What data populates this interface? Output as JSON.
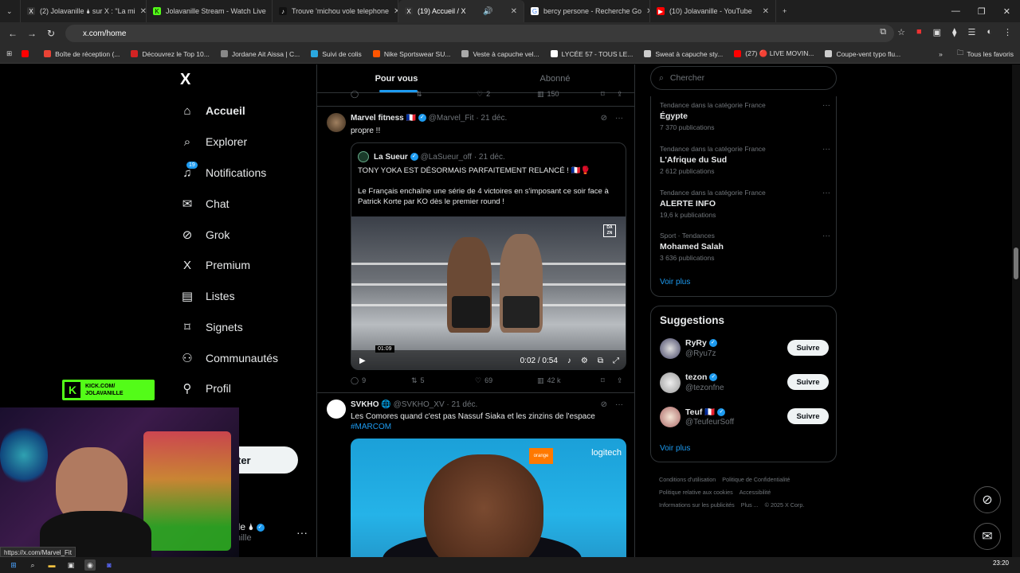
{
  "browser": {
    "tabs": [
      {
        "label": "(2) Jolavanille 🌢 sur X : \"La mi",
        "color": "#000000",
        "glyph": "X"
      },
      {
        "label": "Jolavanille Stream - Watch Live",
        "color": "#53fc18",
        "glyph": "K"
      },
      {
        "label": "Trouve 'michou vole telephone",
        "color": "#111111",
        "glyph": "♪"
      },
      {
        "label": "(19) Accueil / X",
        "color": "#000000",
        "glyph": "X"
      },
      {
        "label": "bercy persone - Recherche Go",
        "color": "#4285f4",
        "glyph": "G"
      },
      {
        "label": "(10) Jolavanille - YouTube",
        "color": "#ff0000",
        "glyph": "▶"
      }
    ],
    "address": "x.com/home",
    "bookmarks": [
      {
        "label": "",
        "color": "#ff0000"
      },
      {
        "label": "",
        "color": "#ea4335"
      },
      {
        "label": "Boîte de réception (...",
        "color": "#ea4335"
      },
      {
        "label": "Découvrez le Top 10...",
        "color": "#d32323"
      },
      {
        "label": "Jordane Ait Aissa | C...",
        "color": "#888888"
      },
      {
        "label": "Suivi de colis",
        "color": "#2aa8e0"
      },
      {
        "label": "Nike Sportswear SU...",
        "color": "#ff5500"
      },
      {
        "label": "Veste à capuche vel...",
        "color": "#aaaaaa"
      },
      {
        "label": "LYCÉE 57 - TOUS LE...",
        "color": "#ffffff"
      },
      {
        "label": "Sweat à capuche sty...",
        "color": "#cccccc"
      },
      {
        "label": "(27) 🔴 LIVE MOVIN...",
        "color": "#ff0000"
      },
      {
        "label": "Coupe-vent typo flu...",
        "color": "#cccccc"
      }
    ],
    "all_favs": "Tous les favoris",
    "status_url": "https://x.com/Marvel_Fit"
  },
  "sidebar": {
    "logo": "X",
    "items": [
      {
        "label": "Accueil",
        "icon": "home-icon",
        "glyph": "⌂",
        "bold": true
      },
      {
        "label": "Explorer",
        "icon": "search-icon",
        "glyph": "⌕",
        "bold": false
      },
      {
        "label": "Notifications",
        "icon": "bell-icon",
        "glyph": "🔔",
        "bold": false,
        "badge": "19"
      },
      {
        "label": "Chat",
        "icon": "mail-icon",
        "glyph": "✉",
        "bold": false
      },
      {
        "label": "Grok",
        "icon": "grok-icon",
        "glyph": "⊘",
        "bold": false
      },
      {
        "label": "Premium",
        "icon": "x-premium-icon",
        "glyph": "X",
        "bold": false
      },
      {
        "label": "Listes",
        "icon": "list-icon",
        "glyph": "▤",
        "bold": false
      },
      {
        "label": "Signets",
        "icon": "bookmark-icon",
        "glyph": "⌑",
        "bold": false
      },
      {
        "label": "Communautés",
        "icon": "communities-icon",
        "glyph": "⚇",
        "bold": false
      },
      {
        "label": "Profil",
        "icon": "profile-icon",
        "glyph": "⚲",
        "bold": false
      }
    ],
    "post_button": "ter",
    "account_name": "lle 🌢",
    "account_handle": "nille"
  },
  "feed": {
    "tabs": [
      {
        "label": "Pour vous",
        "active": true
      },
      {
        "label": "Abonné",
        "active": false
      }
    ],
    "top_actions": {
      "replies": "",
      "reposts": "",
      "likes": "2",
      "views": "150"
    },
    "tweet1": {
      "name": "Marvel fitness 🇫🇷",
      "handle": "@Marvel_Fit · 21 déc.",
      "text": "propre !!",
      "quote": {
        "name": "La Sueur",
        "handle": "@LaSueur_off · 21 déc.",
        "line1": "TONY YOKA EST DÉSORMAIS PARFAITEMENT RELANCÉ ! 🇫🇷🥊",
        "line2": "Le Français enchaîne une série de 4 victoires en s'imposant ce soir face à Patrick Korte par KO dès le premier round !",
        "video_time": "0:02 / 0:54",
        "round_label": "01:09",
        "broadcaster": "DA ZN"
      },
      "actions": {
        "replies": "9",
        "reposts": "5",
        "likes": "69",
        "views": "42 k"
      }
    },
    "tweet2": {
      "name": "SVKHO 🌐",
      "handle": "@SVKHO_XV · 21 déc.",
      "text": "Les Comores quand c'est pas Nassuf Siaka et les zinzins de l'espace",
      "hashtag": "#MARCOM",
      "brands": [
        "orange",
        "logitech"
      ]
    }
  },
  "right": {
    "search_placeholder": "Chercher",
    "trends": [
      {
        "category": "Tendance dans la catégorie France",
        "name": "Égypte",
        "count": "7 370 publications"
      },
      {
        "category": "Tendance dans la catégorie France",
        "name": "L'Afrique du Sud",
        "count": "2 612 publications"
      },
      {
        "category": "Tendance dans la catégorie France",
        "name": "ALERTE INFO",
        "count": "19,6 k publications"
      },
      {
        "category": "Sport · Tendances",
        "name": "Mohamed Salah",
        "count": "3 636 publications"
      }
    ],
    "trends_more": "Voir plus",
    "suggestions_title": "Suggestions",
    "suggestions": [
      {
        "name": "RyRy",
        "handle": "@Ryu7z",
        "follow": "Suivre"
      },
      {
        "name": "tezon",
        "handle": "@tezonfne",
        "follow": "Suivre"
      },
      {
        "name": "Teuf 🇫🇷",
        "handle": "@TeufeurSoff",
        "follow": "Suivre"
      }
    ],
    "suggestions_more": "Voir plus",
    "footer": [
      "Conditions d'utilisation",
      "Politique de Confidentialité",
      "Politique relative aux cookies",
      "Accessibilité",
      "Informations sur les publicités",
      "Plus ...",
      "© 2025 X Corp."
    ]
  },
  "overlay": {
    "kick_line1": "KICK.COM/",
    "kick_line2": "JOLAVANILLE"
  },
  "taskbar": {
    "clock": "23:20"
  }
}
